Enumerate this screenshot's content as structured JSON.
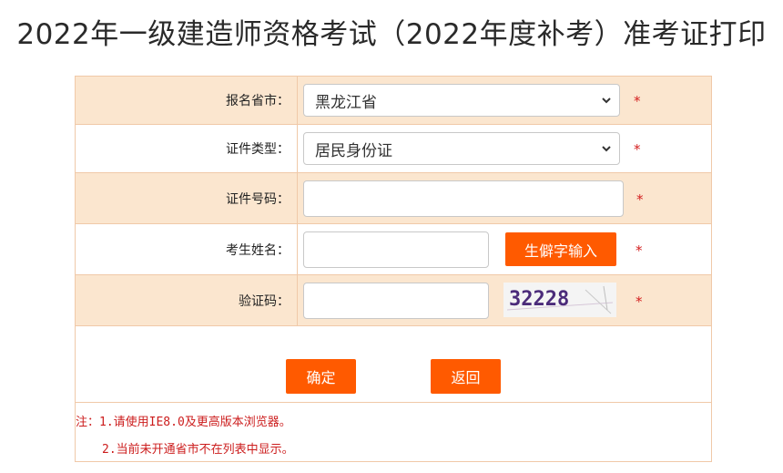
{
  "page": {
    "title": "2022年一级建造师资格考试（2022年度补考）准考证打印"
  },
  "form": {
    "province": {
      "label": "报名省市：",
      "value": "黑龙江省"
    },
    "id_type": {
      "label": "证件类型：",
      "value": "居民身份证"
    },
    "id_number": {
      "label": "证件号码：",
      "value": "",
      "placeholder": ""
    },
    "name": {
      "label": "考生姓名：",
      "value": "",
      "placeholder": "",
      "rare_char_button": "生僻字输入"
    },
    "captcha": {
      "label": "验证码：",
      "value": "",
      "placeholder": "",
      "image_text": "32228"
    },
    "required_mark": "*"
  },
  "actions": {
    "confirm": "确定",
    "back": "返回"
  },
  "notes": {
    "line1": "注：1.请使用IE8.0及更高版本浏览器。",
    "line2": "2.当前未开通省市不在列表中显示。"
  },
  "colors": {
    "accent": "#ff5a00",
    "row_shade": "#fbe6cf",
    "border": "#f0c9a8",
    "required": "#d42020",
    "note": "#cc1d1d"
  }
}
